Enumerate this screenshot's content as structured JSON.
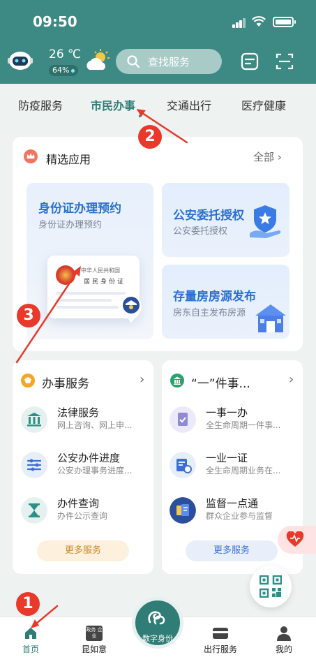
{
  "status": {
    "time": "09:50"
  },
  "header": {
    "temperature": "26 ℃",
    "aqi": "64%",
    "search_placeholder": "查找服务"
  },
  "tabs": [
    {
      "label": "防疫服务"
    },
    {
      "label": "市民办事"
    },
    {
      "label": "交通出行"
    },
    {
      "label": "医疗健康"
    }
  ],
  "featured": {
    "title": "精选应用",
    "all_label": "全部",
    "items": [
      {
        "title": "身份证办理预约",
        "subtitle": "身份证办理预约"
      },
      {
        "title": "公安委托授权",
        "subtitle": "公安委托授权"
      },
      {
        "title": "存量房房源发布",
        "subtitle": "房东自主发布房源"
      }
    ],
    "idcard_line1": "中华人民共和国",
    "idcard_line2": "居民身份证"
  },
  "services": {
    "title": "办事服务",
    "items": [
      {
        "name": "法律服务",
        "desc": "网上咨询、网上申..."
      },
      {
        "name": "公安办件进度",
        "desc": "公安办理事务进度..."
      },
      {
        "name": "办件查询",
        "desc": "办件公示查询"
      }
    ],
    "more_label": "更多服务"
  },
  "one_thing": {
    "title": "“一”件事...",
    "items": [
      {
        "name": "一事一办",
        "desc": "全生命周期一件事..."
      },
      {
        "name": "一业一证",
        "desc": "全生命周期业务在..."
      },
      {
        "name": "监督一点通",
        "desc": "群众企业参与监督"
      }
    ],
    "more_label": "更多服务"
  },
  "bottom_nav": {
    "items": [
      {
        "label": "首页"
      },
      {
        "label": "昆如意"
      },
      {
        "label": "数字身份"
      },
      {
        "label": "出行服务"
      },
      {
        "label": "我的"
      }
    ],
    "card_icon_text": "政务 企业"
  },
  "annotations": [
    "1",
    "2",
    "3"
  ],
  "colors": {
    "header": "#3d8a84",
    "accent": "#2f7d76",
    "annotation": "#e8392b",
    "featured_title": "#2a6fd0"
  }
}
